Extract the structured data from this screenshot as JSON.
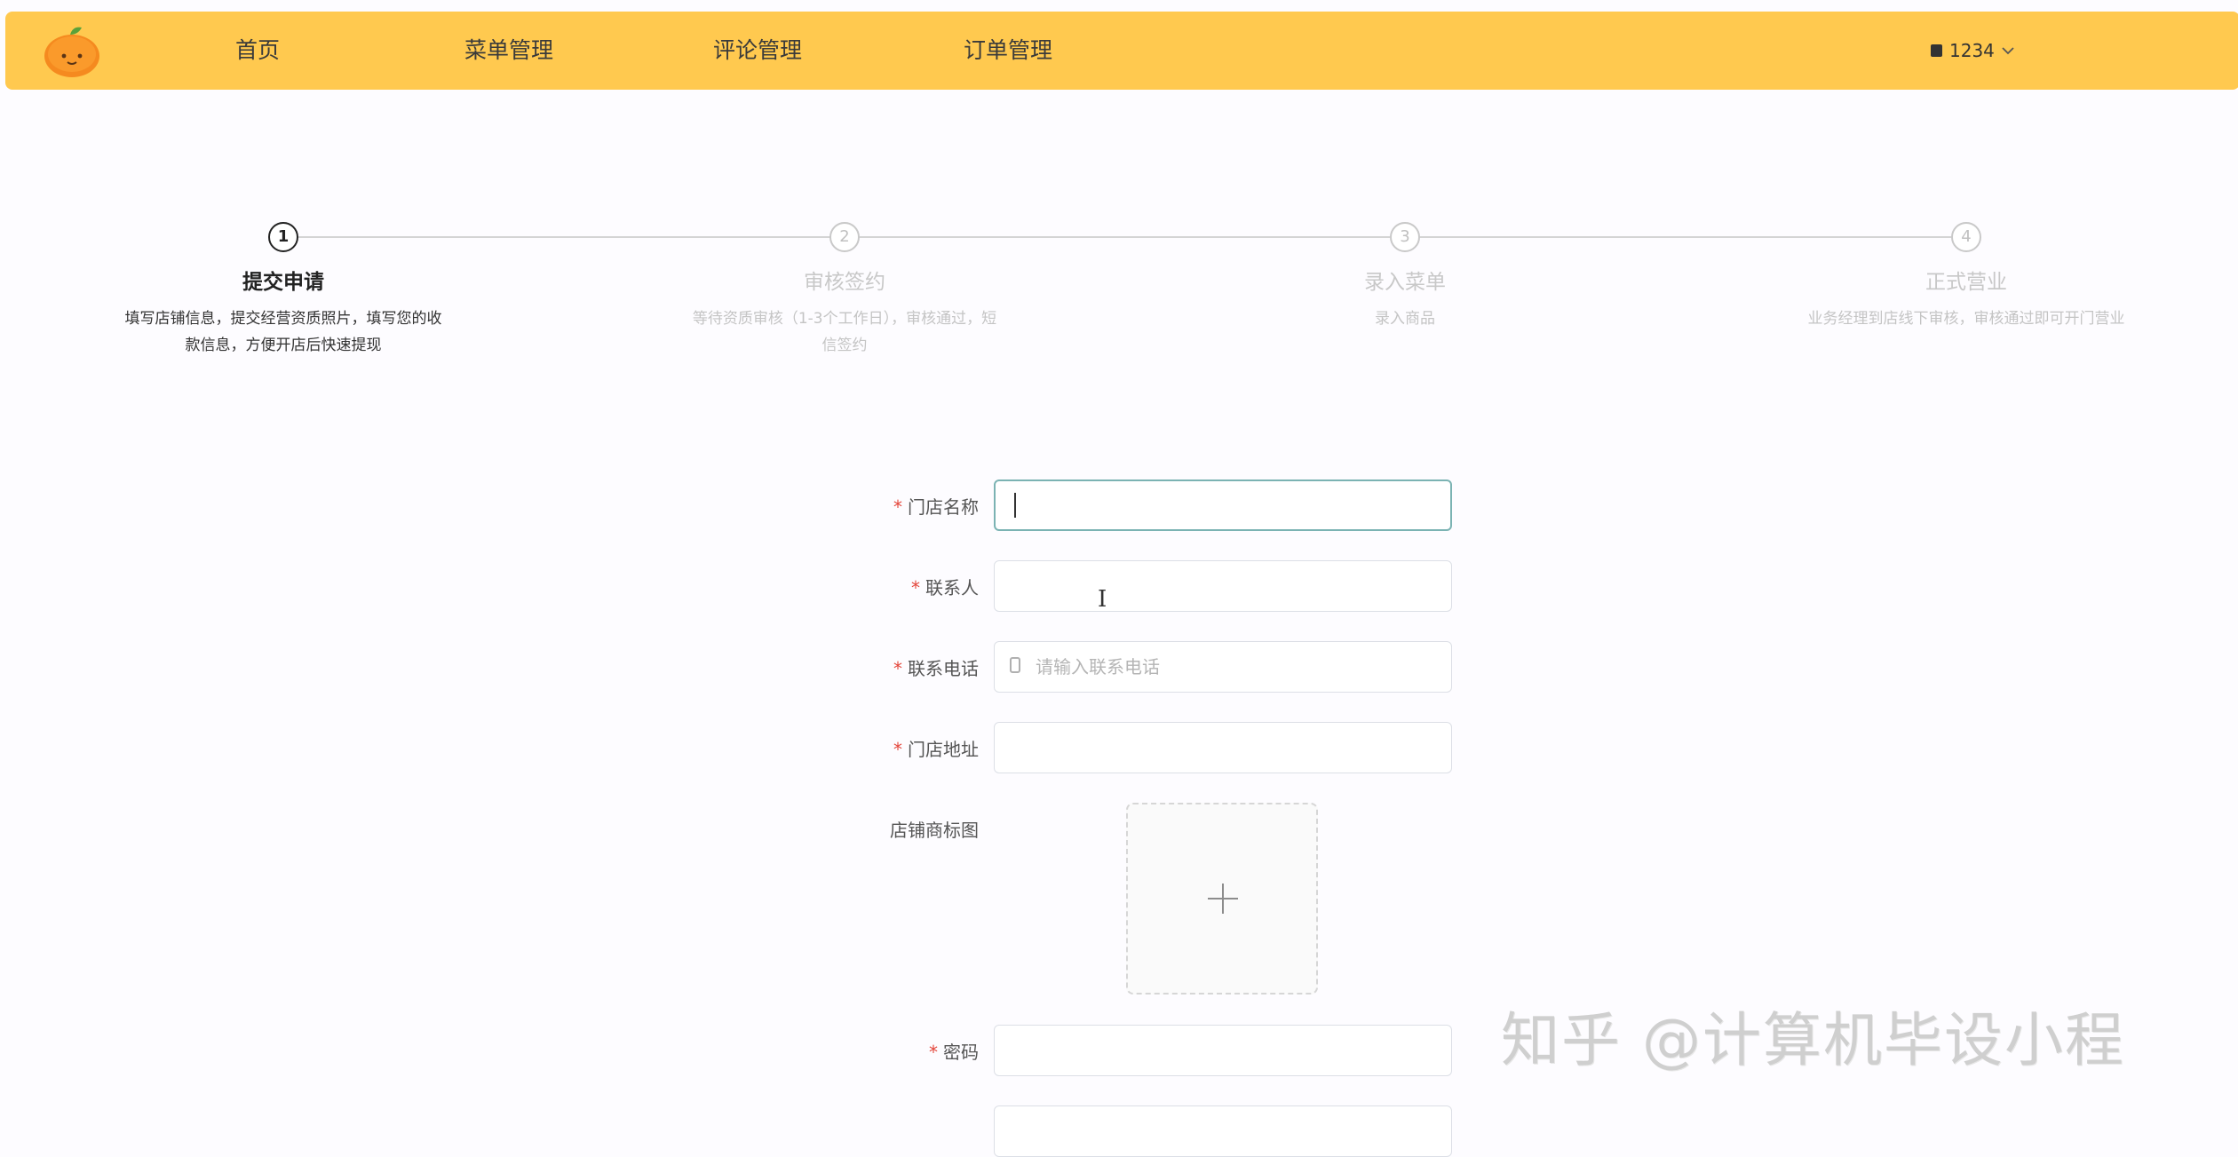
{
  "header": {
    "logo_icon": "orange-logo-icon",
    "nav": [
      "首页",
      "菜单管理",
      "评论管理",
      "订单管理"
    ],
    "user_label": "1234",
    "user_icon": "user-icon",
    "chevron_icon": "chevron-down-icon"
  },
  "steps": [
    {
      "number": "1",
      "title": "提交申请",
      "desc_line1": "填写店铺信息，提交经营资质照片，填写您的收",
      "desc_line2": "款信息，方便开店后快速提现"
    },
    {
      "number": "2",
      "title": "审核签约",
      "desc_line1": "等待资质审核（1-3个工作日），审核通过，短",
      "desc_line2": "信签约"
    },
    {
      "number": "3",
      "title": "录入菜单",
      "desc_line1": "录入商品",
      "desc_line2": ""
    },
    {
      "number": "4",
      "title": "正式营业",
      "desc_line1": "业务经理到店线下审核，审核通过即可开门营业",
      "desc_line2": ""
    }
  ],
  "form": {
    "required_mark": "*",
    "store_name_label": "门店名称",
    "store_name_value": "",
    "contact_label": "联系人",
    "contact_value": "",
    "phone_label": "联系电话",
    "phone_placeholder": "请输入联系电话",
    "phone_icon": "phone-icon",
    "address_label": "门店地址",
    "address_value": "",
    "logo_label": "店铺商标图",
    "upload_icon": "plus-icon",
    "password_label": "密码",
    "password_value": ""
  },
  "watermark": "知乎 @计算机毕设小程",
  "colors": {
    "header_bg": "#ffc94f",
    "required": "#e4453a",
    "focus_border": "#7bb3b3"
  }
}
